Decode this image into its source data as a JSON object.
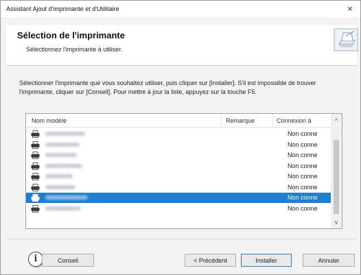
{
  "window": {
    "title": "Assistant Ajout d'imprimante et d'Utilitaire",
    "close_glyph": "×"
  },
  "header": {
    "title": "Sélection de l'imprimante",
    "subtitle": "Sélectionnez l'imprimante à utiliser.",
    "logo_icon": "printer-wizard-icon"
  },
  "instructions": "Sélectionner l'imprimante que vous souhaitez utiliser, puis cliquer sur [Installer]. S'il est impossible de trouver l'imprimante, cliquer sur [Conseil]. Pour mettre à jour la liste, appuyez sur la touche F5.",
  "list": {
    "columns": [
      "Nom modèle",
      "Remarque",
      "Connexion à"
    ],
    "rows": [
      {
        "connection": "Non conne",
        "selected": false
      },
      {
        "connection": "Non conne",
        "selected": false
      },
      {
        "connection": "Non conne",
        "selected": false
      },
      {
        "connection": "Non conne",
        "selected": false
      },
      {
        "connection": "Non conne",
        "selected": false
      },
      {
        "connection": "Non conne",
        "selected": false
      },
      {
        "connection": "Non conne",
        "selected": true
      },
      {
        "connection": "Non conne",
        "selected": false
      }
    ],
    "scroll_up_glyph": "^",
    "scroll_down_glyph": "v"
  },
  "footer": {
    "info_glyph": "i",
    "conseil_label": "Conseil",
    "prev_label": "< Précédent",
    "install_label": "Installer",
    "cancel_label": "Annuler"
  },
  "colors": {
    "selection": "#1e7fd6",
    "default_button_border": "#2b7bd3"
  }
}
